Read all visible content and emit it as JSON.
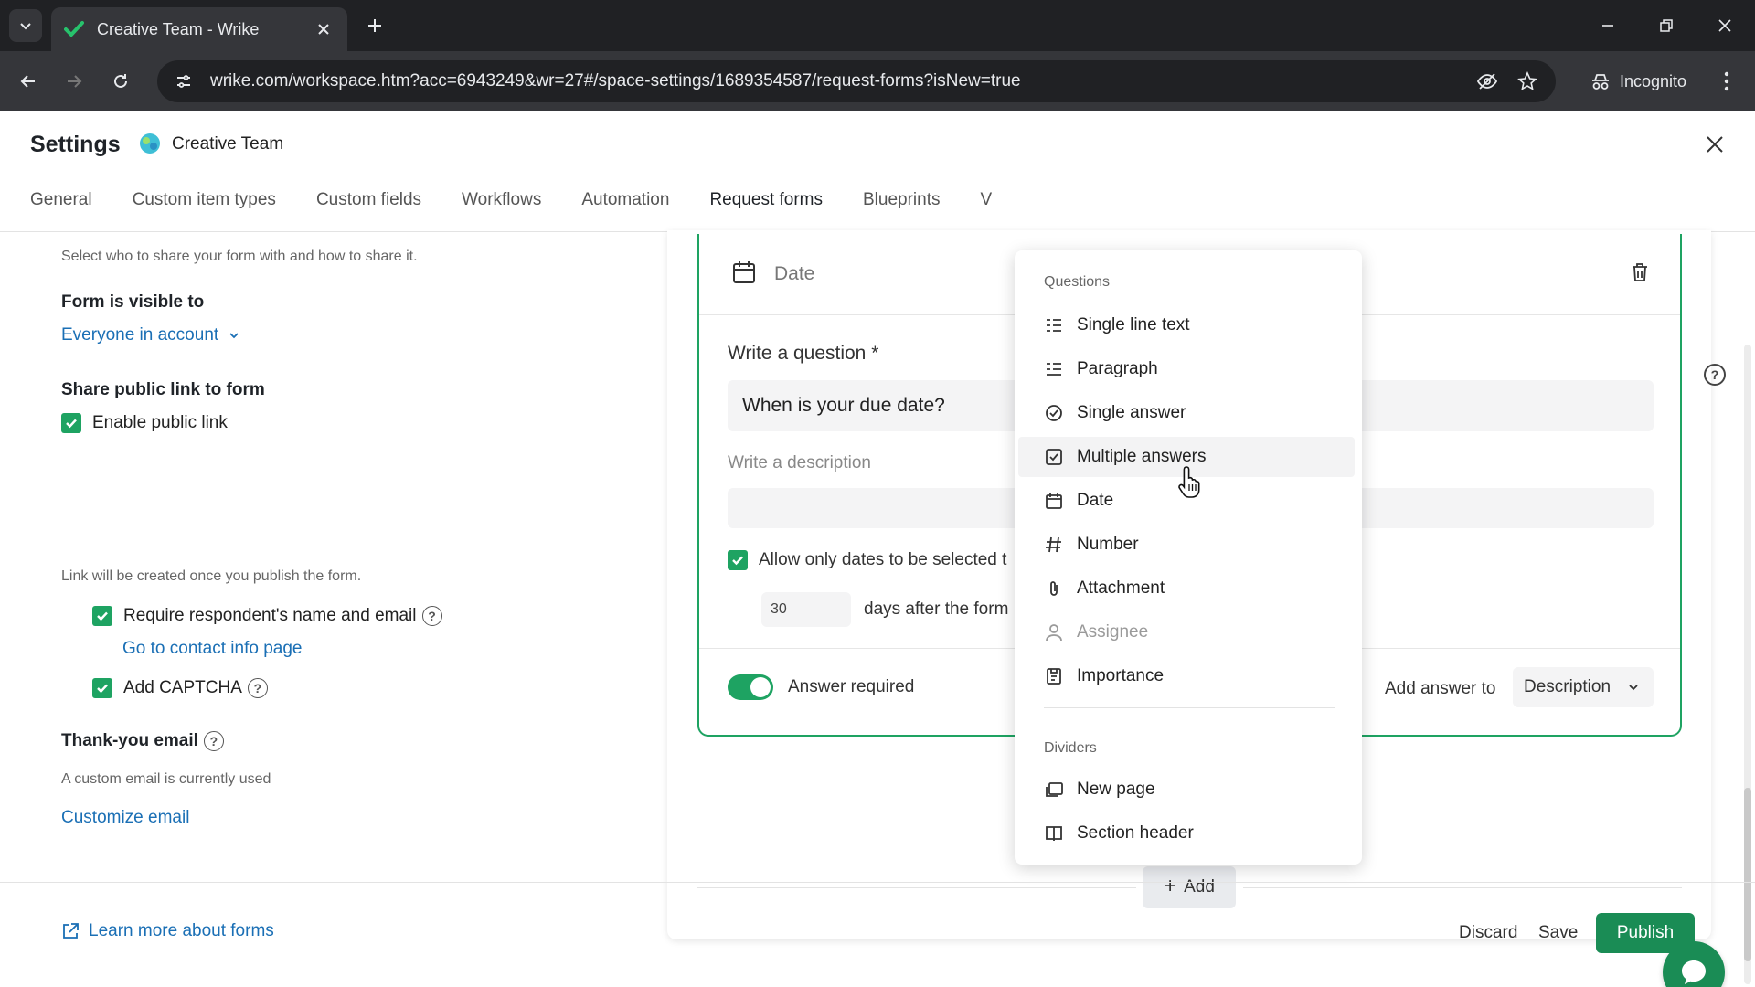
{
  "browser": {
    "tab_title": "Creative Team - Wrike",
    "url": "wrike.com/workspace.htm?acc=6943249&wr=27#/space-settings/1689354587/request-forms?isNew=true",
    "incognito_label": "Incognito"
  },
  "header": {
    "title": "Settings",
    "space_name": "Creative Team",
    "tabs": [
      "General",
      "Custom item types",
      "Custom fields",
      "Workflows",
      "Automation",
      "Request forms",
      "Blueprints",
      "V"
    ],
    "active_tab": "Request forms"
  },
  "left_panel": {
    "intro": "Select who to share your form with and how to share it.",
    "visibility_label": "Form is visible to",
    "visibility_value": "Everyone in account",
    "share_label": "Share public link to form",
    "enable_public_link": "Enable public link",
    "link_note": "Link will be created once you publish the form.",
    "require_name": "Require respondent's name and email",
    "contact_link": "Go to contact info page",
    "captcha": "Add CAPTCHA",
    "thank_you_label": "Thank-you email",
    "thank_you_note": "A custom email is currently used",
    "customize_link": "Customize email"
  },
  "question": {
    "type_label": "Date",
    "write_question_label": "Write a question *",
    "question_value": "When is your due date?",
    "description_placeholder": "Write a description",
    "allow_dates_label": "Allow only dates to be selected t",
    "days_value": "30",
    "days_after_label": "days after the form",
    "answer_required_label": "Answer required",
    "add_answer_to_label": "Add answer to",
    "add_answer_to_value": "Description"
  },
  "add_button": "Add",
  "menu": {
    "questions_header": "Questions",
    "questions": [
      {
        "label": "Single line text",
        "icon": "single-line-text-icon"
      },
      {
        "label": "Paragraph",
        "icon": "paragraph-icon"
      },
      {
        "label": "Single answer",
        "icon": "single-answer-icon"
      },
      {
        "label": "Multiple answers",
        "icon": "multiple-answers-icon"
      },
      {
        "label": "Date",
        "icon": "calendar-icon"
      },
      {
        "label": "Number",
        "icon": "hash-icon"
      },
      {
        "label": "Attachment",
        "icon": "paperclip-icon"
      },
      {
        "label": "Assignee",
        "icon": "person-icon"
      },
      {
        "label": "Importance",
        "icon": "importance-icon"
      }
    ],
    "dividers_header": "Dividers",
    "dividers": [
      {
        "label": "New page",
        "icon": "new-page-icon"
      },
      {
        "label": "Section header",
        "icon": "section-header-icon"
      }
    ]
  },
  "footer": {
    "learn_more": "Learn more about forms",
    "discard": "Discard",
    "save": "Save",
    "publish": "Publish"
  },
  "colors": {
    "accent": "#1ea362",
    "publish": "#1a8c55",
    "link": "#1a6fb5"
  }
}
